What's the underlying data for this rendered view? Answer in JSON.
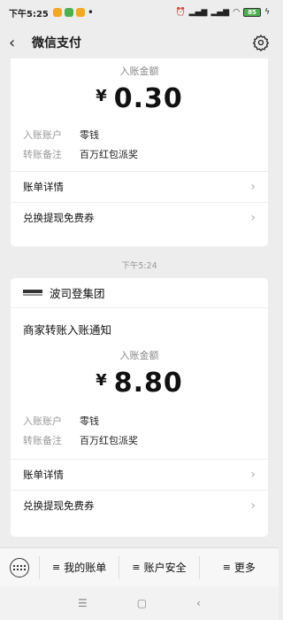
{
  "status_bar": {
    "time": "下午5:25",
    "battery": "85",
    "notif_colors": [
      "#f5a623",
      "#4caf50",
      "#f5a623"
    ]
  },
  "navbar": {
    "back_icon": "back-icon",
    "title": "微信支付",
    "settings_icon": "gear-icon"
  },
  "card1": {
    "amount_label": "入账金额",
    "currency": "¥",
    "amount": "0.30",
    "rows": [
      {
        "key": "入账账户",
        "value": "零钱"
      },
      {
        "key": "转账备注",
        "value": "百万红包派奖"
      }
    ],
    "links": [
      "账单详情",
      "兑换提现免费券"
    ]
  },
  "timestamp": "下午5:24",
  "card2": {
    "merchant_name": "波司登集团",
    "notice_title": "商家转账入账通知",
    "amount_label": "入账金额",
    "currency": "¥",
    "amount": "8.80",
    "rows": [
      {
        "key": "入账账户",
        "value": "零钱"
      },
      {
        "key": "转账备注",
        "value": "百万红包派奖"
      }
    ],
    "links": [
      "账单详情",
      "兑换提现免费券"
    ]
  },
  "bottom_menu": {
    "items": [
      "我的账单",
      "账户安全",
      "更多"
    ]
  },
  "android_nav": {
    "icons": [
      "menu-icon",
      "home-icon",
      "back-icon"
    ]
  }
}
